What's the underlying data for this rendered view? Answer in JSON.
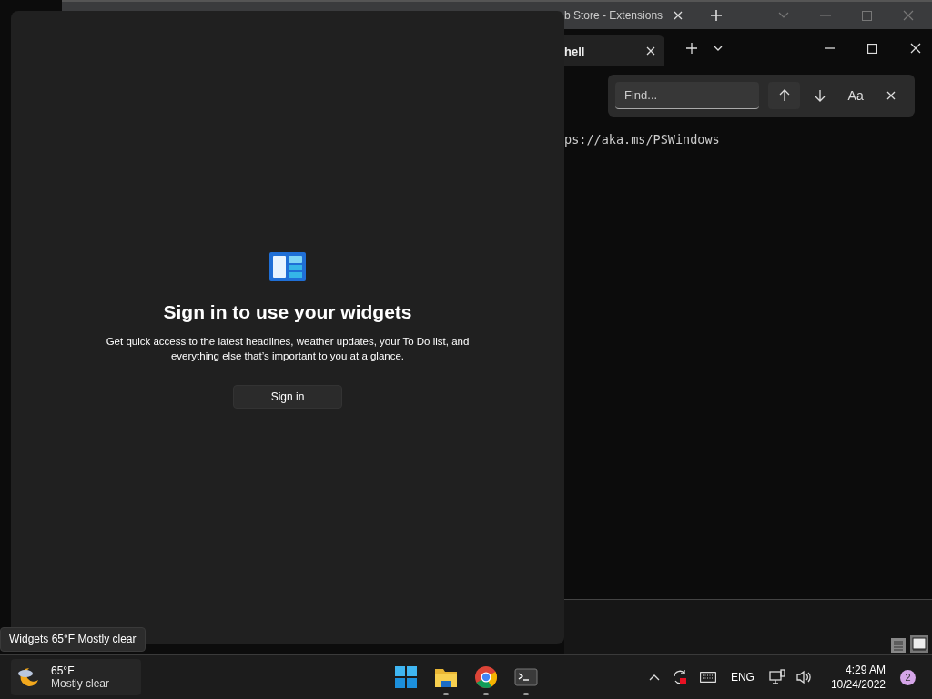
{
  "browser_window": {
    "tab_title": "b Store - Extensions"
  },
  "terminal": {
    "tabs": [
      {
        "label": "hell",
        "selected": true
      }
    ],
    "find": {
      "placeholder": "Find...",
      "case_button": "Aa"
    },
    "lines": [
      "ps://aka.ms/PSWindows"
    ]
  },
  "widgets_panel": {
    "title": "Sign in to use your widgets",
    "description": "Get quick access to the latest headlines, weather updates, your To Do list, and everything else that’s important to you at a glance.",
    "button": "Sign in"
  },
  "tooltip": "Widgets 65°F Mostly clear",
  "taskbar": {
    "weather": {
      "temperature": "65°F",
      "condition": "Mostly clear"
    },
    "apps": [
      {
        "kind": "start",
        "running": false
      },
      {
        "kind": "folder",
        "running": true
      },
      {
        "kind": "chrome",
        "running": true
      },
      {
        "kind": "terminal",
        "running": true
      }
    ],
    "tray": {
      "language": "ENG",
      "time": "4:29 AM",
      "date": "10/24/2022",
      "notifications": "2"
    }
  }
}
